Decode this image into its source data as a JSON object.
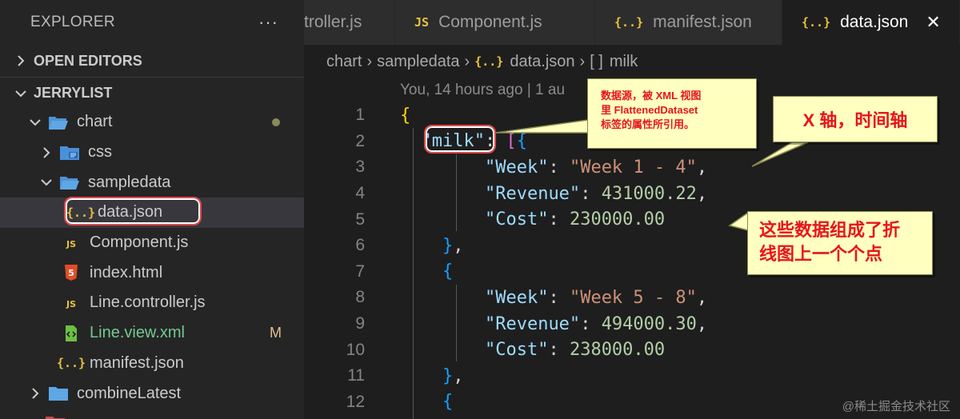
{
  "sidebar": {
    "title": "EXPLORER",
    "more": "···",
    "open_editors": "OPEN EDITORS",
    "project": "JERRYLIST",
    "tree": [
      {
        "label": "chart"
      },
      {
        "label": "css"
      },
      {
        "label": "sampledata"
      },
      {
        "label": "data.json"
      },
      {
        "label": "Component.js"
      },
      {
        "label": "index.html"
      },
      {
        "label": "Line.controller.js"
      },
      {
        "label": "Line.view.xml",
        "status": "M"
      },
      {
        "label": "manifest.json"
      },
      {
        "label": "combineLatest"
      }
    ]
  },
  "tabs": [
    {
      "label": "troller.js"
    },
    {
      "label": "Component.js",
      "icon": "JS"
    },
    {
      "label": "manifest.json",
      "icon": "{..}"
    },
    {
      "label": "data.json",
      "icon": "{..}",
      "close": "✕"
    }
  ],
  "breadcrumb": {
    "items": [
      "chart",
      "sampledata",
      "data.json",
      "milk"
    ],
    "sep": "›",
    "json_icon": "{..}",
    "array_icon": "[ ]"
  },
  "codelens": "You, 14 hours ago | 1 au",
  "line_numbers": [
    "1",
    "2",
    "3",
    "4",
    "5",
    "6",
    "7",
    "8",
    "9",
    "10",
    "11",
    "12"
  ],
  "code": {
    "root_key": "\"milk\"",
    "records": [
      {
        "week_key": "\"Week\"",
        "week_val": "\"Week 1 - 4\"",
        "rev_key": "\"Revenue\"",
        "rev_val": "431000.22",
        "cost_key": "\"Cost\"",
        "cost_val": "230000.00"
      },
      {
        "week_key": "\"Week\"",
        "week_val": "\"Week 5 - 8\"",
        "rev_key": "\"Revenue\"",
        "rev_val": "494000.30",
        "cost_key": "\"Cost\"",
        "cost_val": "238000.00"
      }
    ]
  },
  "callouts": {
    "datasource": [
      "数据源，被 XML 视图",
      "里 FlattenedDataset",
      "标签的属性所引用。"
    ],
    "xaxis": "X 轴，时间轴",
    "points": [
      "这些数据组成了折",
      "线图上一个个点"
    ]
  },
  "watermark": "@稀土掘金技术社区",
  "colors": {
    "sidebar_bg": "#252526",
    "editor_bg": "#1e1e1e",
    "callout_bg": "#ffffc0",
    "callout_text": "#e8141b",
    "highlight_border": "#e04848",
    "json_icon": "#e8c33a",
    "js_icon": "#e8c33a",
    "html_icon": "#e44d26",
    "xml_icon": "#6cbf43",
    "folder_icon": "#5ea7e4"
  }
}
